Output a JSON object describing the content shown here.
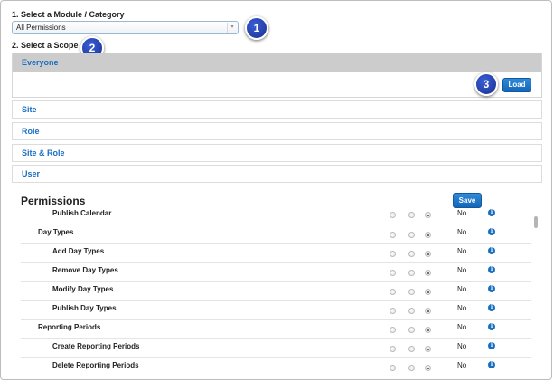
{
  "step1": {
    "label": "1. Select a Module / Category",
    "selected": "All Permissions",
    "arrow": "▾"
  },
  "step2": {
    "label": "2. Select a Scope"
  },
  "badges": [
    "1",
    "2",
    "3"
  ],
  "scopes": {
    "active": "Everyone",
    "items": [
      "Site",
      "Role",
      "Site & Role",
      "User"
    ]
  },
  "load_label": "Load",
  "permissions": {
    "title": "Permissions",
    "save_label": "Save",
    "rows": [
      {
        "label": "Publish Calendar",
        "value": "No"
      },
      {
        "label": "Day Types",
        "value": "No"
      },
      {
        "label": "Add Day Types",
        "value": "No"
      },
      {
        "label": "Remove Day Types",
        "value": "No"
      },
      {
        "label": "Modify Day Types",
        "value": "No"
      },
      {
        "label": "Publish Day Types",
        "value": "No"
      },
      {
        "label": "Reporting Periods",
        "value": "No"
      },
      {
        "label": "Create Reporting Periods",
        "value": "No"
      },
      {
        "label": "Delete Reporting Periods",
        "value": "No"
      }
    ],
    "info_glyph": "i"
  },
  "colors": {
    "accent": "#1a6ec0",
    "badge": "#1f3aa8",
    "header_bg": "#cccccc"
  }
}
